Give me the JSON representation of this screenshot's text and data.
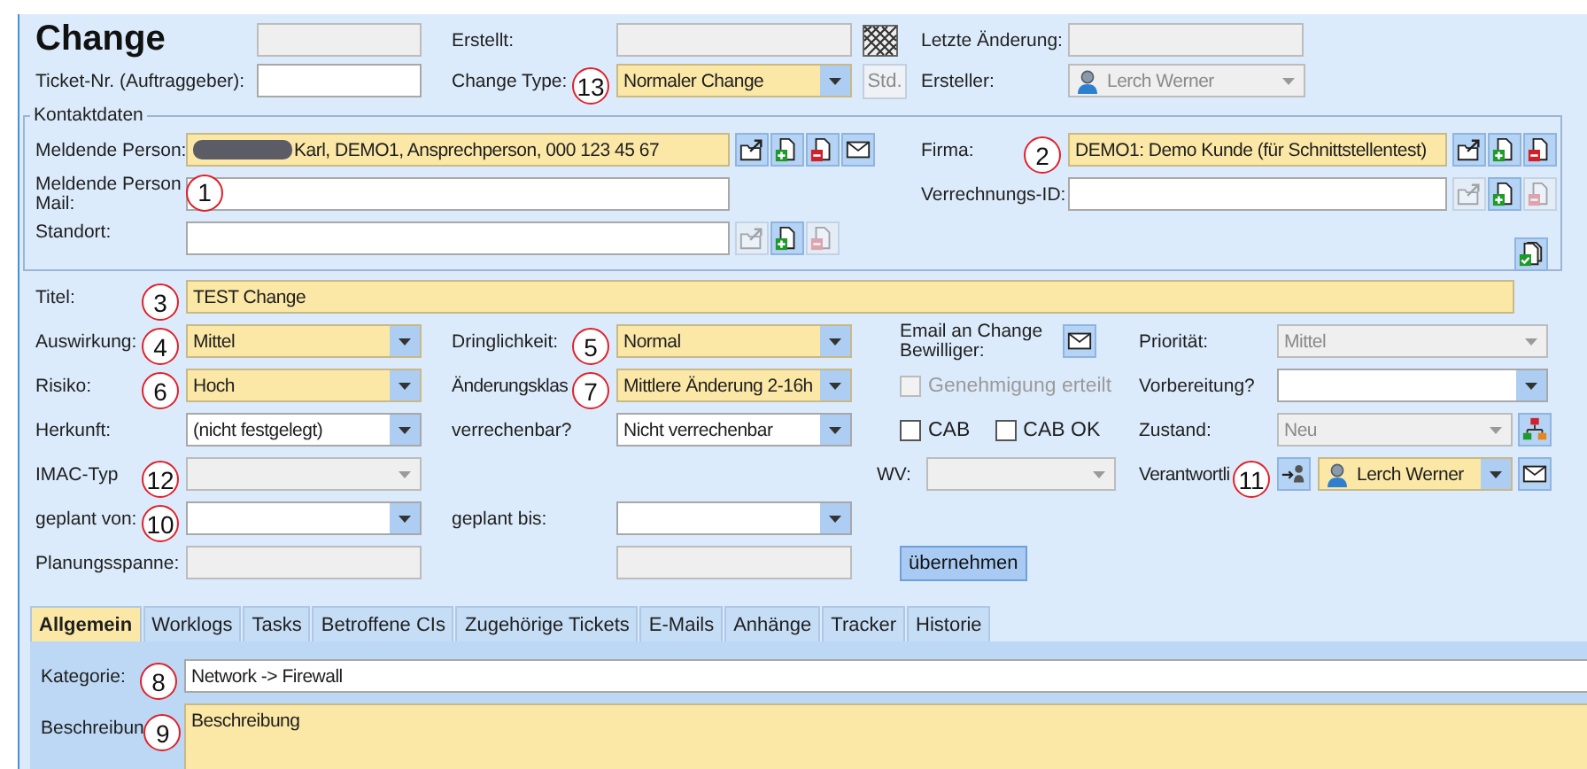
{
  "header": {
    "title": "Change",
    "number_field": {
      "disabled": true
    },
    "ticket_nr": {
      "label": "Ticket-Nr. (Auftraggeber):"
    },
    "created": {
      "label": "Erstellt:",
      "disabled": true
    },
    "change_type": {
      "label": "Change Type:",
      "callout": "13",
      "value": "Normaler Change",
      "required": true
    },
    "std_button": {
      "label": "Std.",
      "disabled": true
    },
    "last_change": {
      "label": "Letzte Änderung:",
      "disabled": true
    },
    "creator": {
      "label": "Ersteller:",
      "value": "Lerch Werner",
      "disabled": true
    }
  },
  "contact": {
    "legend": "Kontaktdaten",
    "reporter": {
      "label": "Meldende Person:",
      "value": "Karl, DEMO1, Ansprechperson, 000 123 45 67",
      "required": true,
      "actions": [
        {
          "disabled": false
        },
        {
          "disabled": false
        },
        {
          "disabled": false
        },
        {
          "disabled": false
        }
      ]
    },
    "company": {
      "label": "Firma:",
      "callout": "2",
      "value": "DEMO1: Demo Kunde (für Schnittstellentest)",
      "required": true,
      "actions": [
        {
          "disabled": false
        },
        {
          "disabled": false
        },
        {
          "disabled": false
        }
      ]
    },
    "reporter_mail": {
      "label": "Meldende Person Mail:",
      "callout": "1"
    },
    "billing_id": {
      "label": "Verrechnungs-ID:",
      "actions": [
        {
          "disabled": true
        },
        {
          "disabled": false
        },
        {
          "disabled": true
        }
      ]
    },
    "location": {
      "label": "Standort:",
      "actions": [
        {
          "disabled": true
        },
        {
          "disabled": false
        },
        {
          "disabled": true
        }
      ]
    }
  },
  "form": {
    "title": {
      "label": "Titel:",
      "callout": "3",
      "value": "TEST Change",
      "required": true
    },
    "impact": {
      "label": "Auswirkung:",
      "callout": "4",
      "value": "Mittel",
      "required": true
    },
    "urgency": {
      "label": "Dringlichkeit:",
      "callout": "5",
      "value": "Normal",
      "required": true
    },
    "approver_mail": {
      "label": "Email an Change Bewilliger:"
    },
    "priority": {
      "label": "Priorität:",
      "value": "Mittel",
      "disabled": true
    },
    "risk": {
      "label": "Risiko:",
      "callout": "6",
      "value": "Hoch",
      "required": true
    },
    "change_class": {
      "label": "Änderungsklas",
      "callout": "7",
      "value": "Mittlere Änderung 2-16h",
      "required": true
    },
    "approval": {
      "label": "Genehmigung erteilt",
      "checked": false,
      "disabled": true
    },
    "preparation": {
      "label": "Vorbereitung?"
    },
    "origin": {
      "label": "Herkunft:",
      "value": "(nicht festgelegt)"
    },
    "billable": {
      "label": "verrechenbar?",
      "value": "Nicht verrechenbar"
    },
    "cab": {
      "label": "CAB",
      "checked": false
    },
    "cab_ok": {
      "label": "CAB OK",
      "checked": false
    },
    "state": {
      "label": "Zustand:",
      "value": "Neu",
      "disabled": true
    },
    "imac_type": {
      "label": "IMAC-Typ",
      "callout": "12",
      "disabled": true
    },
    "wv": {
      "label": "WV:",
      "disabled": true
    },
    "responsible": {
      "label": "Verantwortli",
      "callout": "11",
      "value": "Lerch Werner",
      "required": true
    },
    "planned_from": {
      "label": "geplant von:",
      "callout": "10"
    },
    "planned_to": {
      "label": "geplant bis:"
    },
    "planning_span": {
      "label": "Planungsspanne:",
      "disabled": true
    },
    "planning_span_end": {
      "disabled": true
    },
    "apply_button": {
      "label": "übernehmen"
    }
  },
  "tabs": [
    {
      "label": "Allgemein",
      "selected": true
    },
    {
      "label": "Worklogs",
      "selected": false
    },
    {
      "label": "Tasks",
      "selected": false
    },
    {
      "label": "Betroffene CIs",
      "selected": false
    },
    {
      "label": "Zugehörige Tickets",
      "selected": false
    },
    {
      "label": "E-Mails",
      "selected": false
    },
    {
      "label": "Anhänge",
      "selected": false
    },
    {
      "label": "Tracker",
      "selected": false
    },
    {
      "label": "Historie",
      "selected": false
    }
  ],
  "general": {
    "category": {
      "label": "Kategorie:",
      "callout": "8",
      "value": "Network -> Firewall"
    },
    "description": {
      "label": "Beschreibun",
      "callout": "9",
      "value": "Beschreibung",
      "required": true
    }
  }
}
